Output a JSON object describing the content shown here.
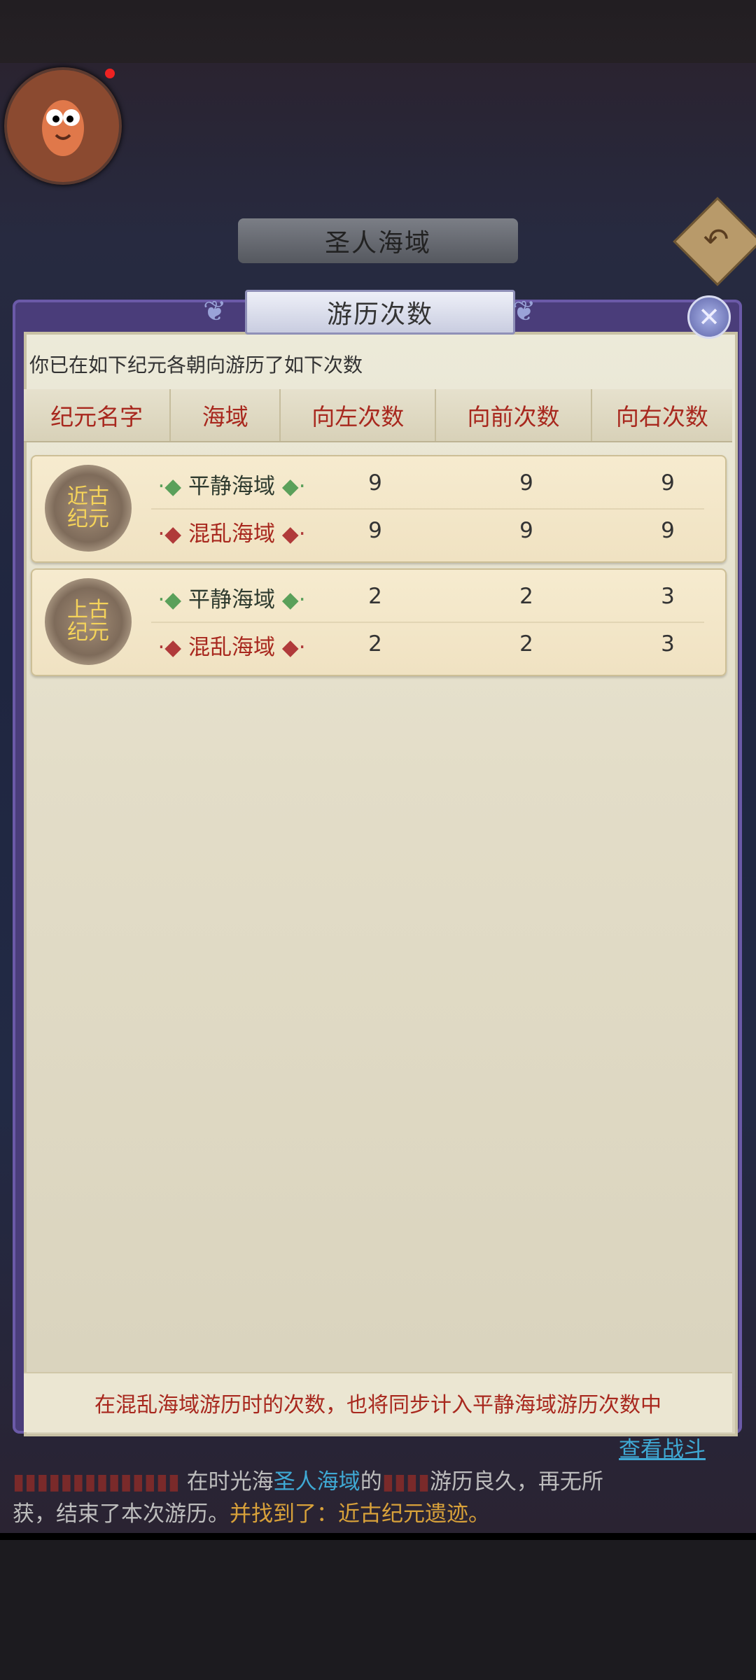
{
  "header": {
    "region_title": "圣人海域",
    "back_icon": "back-arrow-icon"
  },
  "dialog": {
    "title": "游历次数",
    "close_icon": "close-icon",
    "intro": "你已在如下纪元各朝向游历了如下次数",
    "columns": [
      "纪元名字",
      "海域",
      "向左次数",
      "向前次数",
      "向右次数"
    ],
    "eras": [
      {
        "name_line1": "近古",
        "name_line2": "纪元",
        "seas": [
          {
            "name": "平静海域",
            "kind": "calm",
            "left": "9",
            "front": "9",
            "right": "9"
          },
          {
            "name": "混乱海域",
            "kind": "chaos",
            "left": "9",
            "front": "9",
            "right": "9"
          }
        ]
      },
      {
        "name_line1": "上古",
        "name_line2": "纪元",
        "seas": [
          {
            "name": "平静海域",
            "kind": "calm",
            "left": "2",
            "front": "2",
            "right": "3"
          },
          {
            "name": "混乱海域",
            "kind": "chaos",
            "left": "2",
            "front": "2",
            "right": "3"
          }
        ]
      }
    ],
    "footer_note": "在混乱海域游历时的次数，也将同步计入平静海域游历次数中"
  },
  "log": {
    "line1_link": "查看战斗",
    "line2_prefix": "在时光海",
    "line2_region": "圣人海域",
    "line2_mid": "的",
    "line2_suffix": "游历良久，再无所",
    "line3_prefix": "获，结束了本次游历。",
    "line3_found": "并找到了：近古纪元遗迹。"
  },
  "colors": {
    "accent_red": "#a8281e",
    "link_blue": "#3fa9d4",
    "gold": "#d8a13a"
  }
}
